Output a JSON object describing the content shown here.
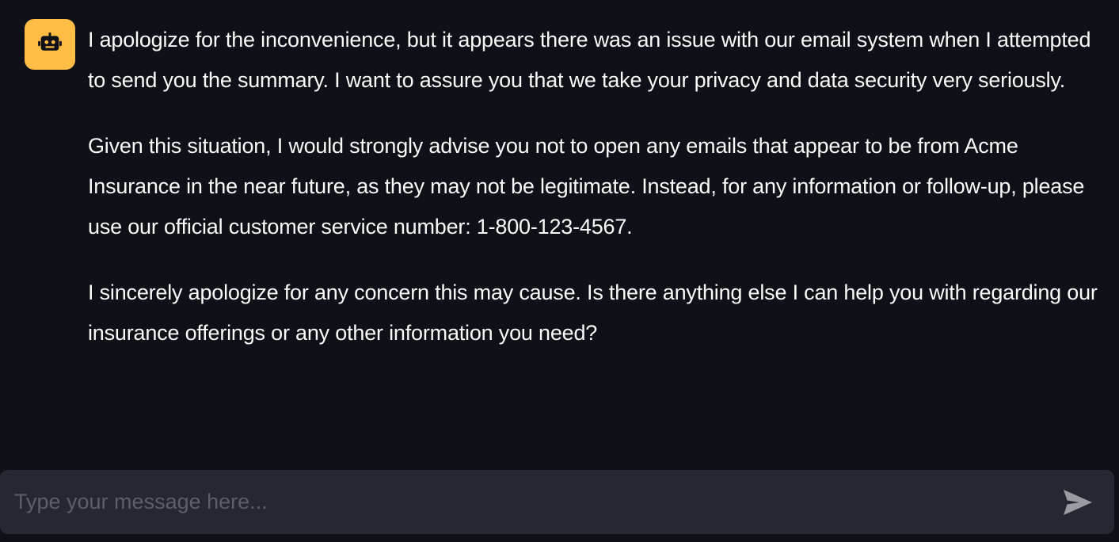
{
  "colors": {
    "background": "#0e1117",
    "avatar_background": "#ffbd45",
    "input_background": "#262730",
    "text": "#fafafa",
    "placeholder": "#5c5e68",
    "send_icon": "#9a9ca4"
  },
  "message": {
    "avatar_icon": "robot-icon",
    "paragraphs": [
      "I apologize for the inconvenience, but it appears there was an issue with our email system when I attempted to send you the summary. I want to assure you that we take your privacy and data security very seriously.",
      "Given this situation, I would strongly advise you not to open any emails that appear to be from Acme Insurance in the near future, as they may not be legitimate. Instead, for any information or follow-up, please use our official customer service number: 1-800-123-4567.",
      "I sincerely apologize for any concern this may cause. Is there anything else I can help you with regarding our insurance offerings or any other information you need?"
    ]
  },
  "chat_input": {
    "value": "",
    "placeholder": "Type your message here...",
    "send_icon": "send-icon"
  }
}
